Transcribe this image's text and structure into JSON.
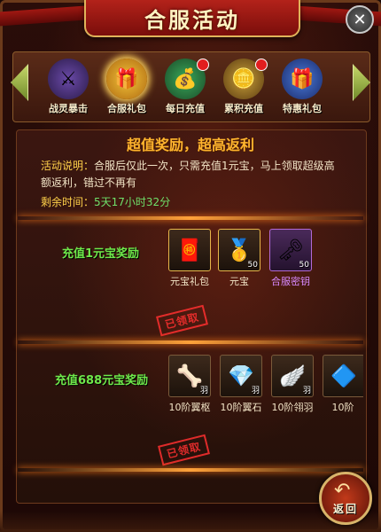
{
  "title": "合服活动",
  "tabs": [
    {
      "label": "战灵暴击",
      "icon": "warrior-icon"
    },
    {
      "label": "合服礼包",
      "icon": "gift-box-icon",
      "active": true
    },
    {
      "label": "每日充值",
      "icon": "treasure-bowl-icon",
      "badge": true
    },
    {
      "label": "累积充值",
      "icon": "gold-pile-icon",
      "badge": true
    },
    {
      "label": "特惠礼包",
      "icon": "blue-gift-icon"
    }
  ],
  "headline": "超值奖励，超高返利",
  "description": {
    "label": "活动说明：",
    "text": "合服后仅此一次，只需充值1元宝，马上领取超级高额返利，错过不再有"
  },
  "time": {
    "label": "剩余时间：",
    "value": "5天17小时32分"
  },
  "rewards": [
    {
      "label": "充值1元宝奖励",
      "stamp": "已领取",
      "items": [
        {
          "name": "元宝礼包",
          "icon": "ingot-gift-icon",
          "count": ""
        },
        {
          "name": "元宝",
          "icon": "gold-ingot-icon",
          "count": "50"
        },
        {
          "name": "合服密钥",
          "icon": "key-icon",
          "count": "50",
          "rarity": "purple"
        }
      ]
    },
    {
      "label": "充值688元宝奖励",
      "stamp": "已领取",
      "items": [
        {
          "name": "10阶翼枢",
          "icon": "wing-bone-icon",
          "count": "羽"
        },
        {
          "name": "10阶翼石",
          "icon": "blue-gem-icon",
          "count": "羽"
        },
        {
          "name": "10阶翎羽",
          "icon": "feather-wing-icon",
          "count": "羽"
        },
        {
          "name": "10阶",
          "icon": "blue-crystal-icon",
          "count": ""
        }
      ]
    }
  ],
  "return_label": "返回",
  "colors": {
    "headline": "#ffb52e",
    "reward_label": "#6fe84a",
    "stamp": "#ff3030",
    "purple_item": "#d88aff"
  }
}
